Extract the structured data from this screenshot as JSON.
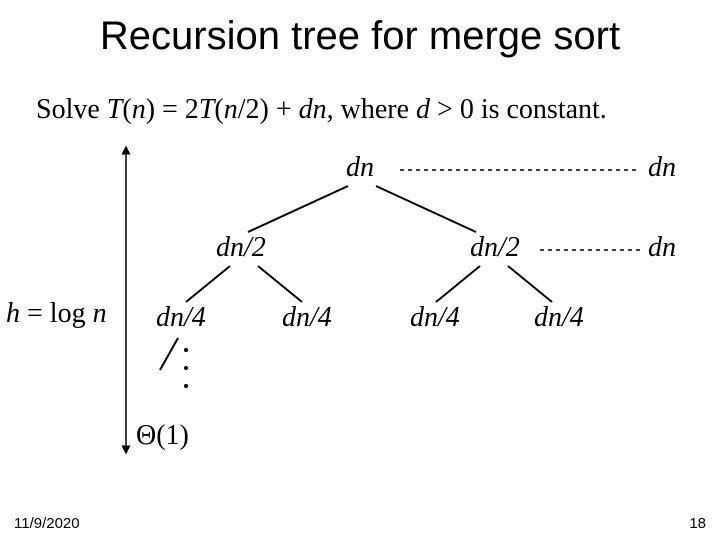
{
  "title": "Recursion tree for merge sort",
  "equation": {
    "lead": "Solve ",
    "Tn": "T",
    "n": "n",
    "eq": " = 2",
    "T": "T",
    "arg2": "n",
    "over2": "/2) + ",
    "d": "d",
    "n2": "n",
    "tail": ", where ",
    "d2": "d",
    "cond": " > 0 is constant."
  },
  "tree": {
    "root": "dn",
    "l1_left": "dn/2",
    "l1_right": "dn/2",
    "l2_a": "dn/4",
    "l2_b": "dn/4",
    "l2_c": "dn/4",
    "l2_d": "dn/4",
    "leaf": "Θ(1)"
  },
  "rowcost": {
    "r0": "dn",
    "r1": "dn"
  },
  "height": {
    "h": "h",
    "rest": " = log ",
    "n": "n"
  },
  "footer": {
    "date": "11/9/2020",
    "page": "18"
  }
}
